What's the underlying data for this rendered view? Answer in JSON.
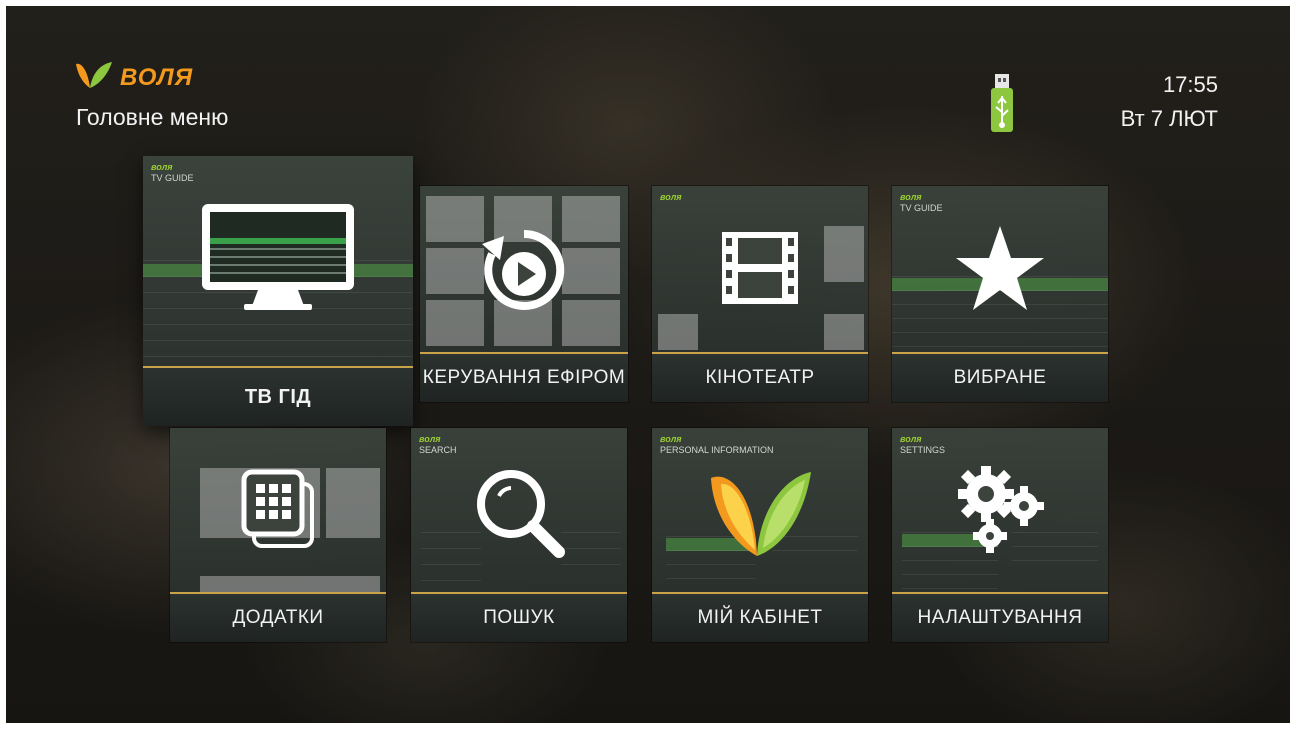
{
  "header": {
    "brand_name": "ВОЛЯ",
    "page_title": "Головне меню",
    "time": "17:55",
    "date": "Вт 7 ЛЮТ"
  },
  "icons": {
    "usb": "usb-icon",
    "tv_guide": "monitor-icon",
    "control": "replay-play-icon",
    "cinema": "film-strip-icon",
    "favorites": "star-icon",
    "apps": "apps-grid-icon",
    "search": "magnifier-icon",
    "cabinet": "volia-leaf-logo-icon",
    "settings": "gears-icon"
  },
  "colors": {
    "brand_orange": "#f39a1e",
    "brand_green": "#8dc63f",
    "label_accent_line": "#c9a24a",
    "tile_bg": "#3c423c"
  },
  "menu": {
    "focused_item": "ТВ ГІД",
    "tiles": [
      {
        "id": "tv_guide",
        "label": "ТВ ГІД"
      },
      {
        "id": "control",
        "label": "КЕРУВАННЯ ЕФІРОМ"
      },
      {
        "id": "cinema",
        "label": "КІНОТЕАТР"
      },
      {
        "id": "favorites",
        "label": "ВИБРАНЕ"
      },
      {
        "id": "apps",
        "label": "ДОДАТКИ"
      },
      {
        "id": "search",
        "label": "ПОШУК"
      },
      {
        "id": "cabinet",
        "label": "МІЙ КАБІНЕТ"
      },
      {
        "id": "settings",
        "label": "НАЛАШТУВАННЯ"
      }
    ]
  },
  "previews": {
    "tv_guide_title": "TV GUIDE",
    "favorites_title": "TV GUIDE",
    "search_title": "SEARCH",
    "cabinet_title": "PERSONAL INFORMATION",
    "settings_title": "SETTINGS",
    "mini_brand": "воля"
  }
}
